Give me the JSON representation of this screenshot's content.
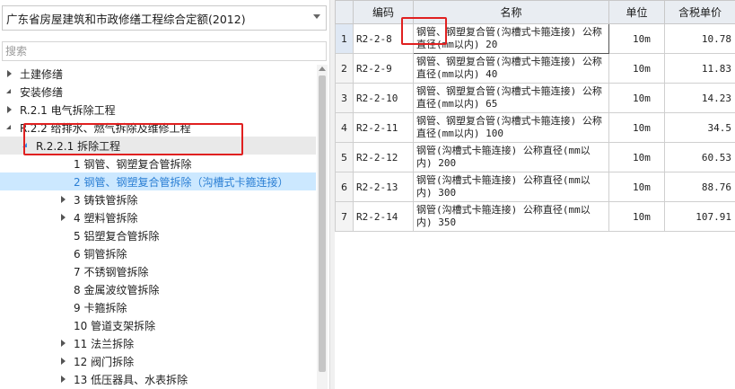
{
  "quota_library": {
    "selected": "广东省房屋建筑和市政修缮工程综合定额(2012)"
  },
  "search": {
    "placeholder": "搜索"
  },
  "tree": [
    {
      "label": "土建修缮",
      "state": "collapsed",
      "level": 0
    },
    {
      "label": "安装修缮",
      "state": "expanded",
      "level": 0
    },
    {
      "label": "R.2.1 电气拆除工程",
      "state": "collapsed",
      "level": 1
    },
    {
      "label": "R.2.2 给排水、燃气拆除及维修工程",
      "state": "expanded",
      "level": 1
    },
    {
      "label": "R.2.2.1 拆除工程",
      "state": "expanded",
      "level": 2,
      "active": true
    },
    {
      "label": "1 钢管、钢塑复合管拆除",
      "state": "none",
      "level": 3
    },
    {
      "label": "2 钢管、钢塑复合管拆除（沟槽式卡箍连接）",
      "state": "none",
      "level": 3,
      "selected": true
    },
    {
      "label": "3 铸铁管拆除",
      "state": "collapsed",
      "level": 3
    },
    {
      "label": "4 塑料管拆除",
      "state": "collapsed",
      "level": 3
    },
    {
      "label": "5 铝塑复合管拆除",
      "state": "none",
      "level": 3
    },
    {
      "label": "6 铜管拆除",
      "state": "none",
      "level": 3
    },
    {
      "label": "7 不锈钢管拆除",
      "state": "none",
      "level": 3
    },
    {
      "label": "8 金属波纹管拆除",
      "state": "none",
      "level": 3
    },
    {
      "label": "9 卡箍拆除",
      "state": "none",
      "level": 3
    },
    {
      "label": "10 管道支架拆除",
      "state": "none",
      "level": 3
    },
    {
      "label": "11 法兰拆除",
      "state": "collapsed",
      "level": 3
    },
    {
      "label": "12 阀门拆除",
      "state": "collapsed",
      "level": 3
    },
    {
      "label": "13 低压器具、水表拆除",
      "state": "collapsed",
      "level": 3
    }
  ],
  "grid": {
    "headers": {
      "rownum": "",
      "code": "编码",
      "name": "名称",
      "unit": "单位",
      "price": "含税单价"
    },
    "rows": [
      {
        "n": "1",
        "code": "R2-2-8",
        "name": "钢管、钢塑复合管(沟槽式卡箍连接) 公称直径(mm以内) 20",
        "unit": "10m",
        "price": "10.78",
        "selected": true
      },
      {
        "n": "2",
        "code": "R2-2-9",
        "name": "钢管、钢塑复合管(沟槽式卡箍连接) 公称直径(mm以内) 40",
        "unit": "10m",
        "price": "11.83"
      },
      {
        "n": "3",
        "code": "R2-2-10",
        "name": "钢管、钢塑复合管(沟槽式卡箍连接) 公称直径(mm以内) 65",
        "unit": "10m",
        "price": "14.23"
      },
      {
        "n": "4",
        "code": "R2-2-11",
        "name": "钢管、钢塑复合管(沟槽式卡箍连接) 公称直径(mm以内) 100",
        "unit": "10m",
        "price": "34.5"
      },
      {
        "n": "5",
        "code": "R2-2-12",
        "name": "钢管(沟槽式卡箍连接) 公称直径(mm以内) 200",
        "unit": "10m",
        "price": "60.53"
      },
      {
        "n": "6",
        "code": "R2-2-13",
        "name": "钢管(沟槽式卡箍连接) 公称直径(mm以内) 300",
        "unit": "10m",
        "price": "88.76"
      },
      {
        "n": "7",
        "code": "R2-2-14",
        "name": "钢管(沟槽式卡箍连接) 公称直径(mm以内) 350",
        "unit": "10m",
        "price": "107.91"
      }
    ]
  },
  "colors": {
    "selection": "#cce8ff",
    "selection_text": "#2b7fd4",
    "annotation": "#e02020",
    "header_bg": "#e9edf2"
  }
}
